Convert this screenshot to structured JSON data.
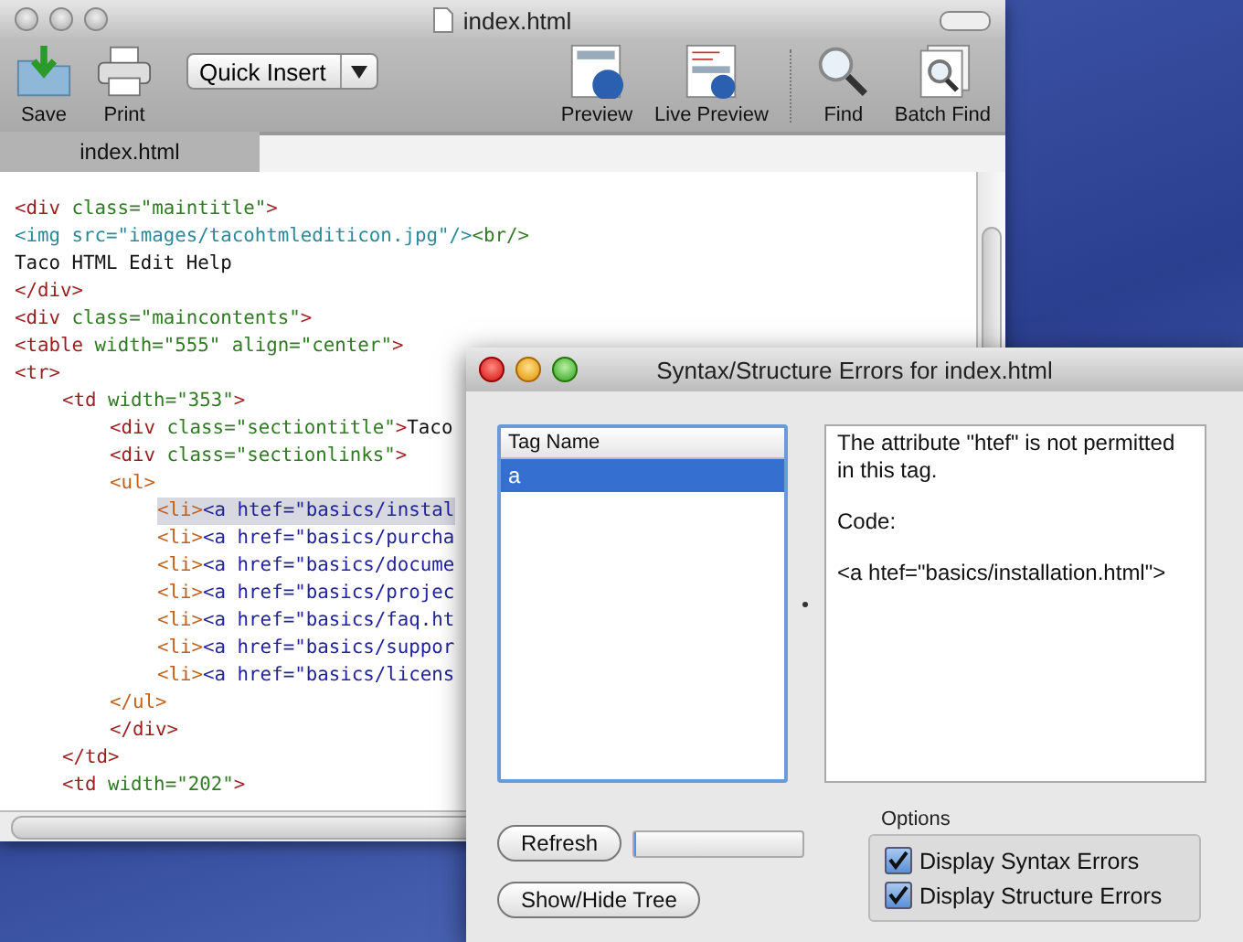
{
  "editor": {
    "title": "index.html",
    "toolbar_left": [
      {
        "label": "Save"
      },
      {
        "label": "Print"
      }
    ],
    "quick_insert": {
      "label": "Quick Insert"
    },
    "toolbar_right": [
      {
        "label": "Preview"
      },
      {
        "label": "Live Preview"
      },
      {
        "label": "Find"
      },
      {
        "label": "Batch Find"
      }
    ],
    "tabs": [
      {
        "label": "index.html",
        "selected": true
      }
    ],
    "code_lines": [
      {
        "highlighted": false,
        "segments": [
          {
            "kind": "tag",
            "text": "<div"
          },
          {
            "kind": "attr",
            "text": " class=\"maintitle\""
          },
          {
            "kind": "tag",
            "text": ">"
          }
        ]
      },
      {
        "highlighted": false,
        "segments": [
          {
            "kind": "img",
            "text": "<img src=\"images/tacohtmlediticon.jpg\"/>"
          },
          {
            "kind": "attr",
            "text": "<br/>"
          }
        ]
      },
      {
        "highlighted": false,
        "segments": [
          {
            "kind": "text",
            "text": "Taco HTML Edit Help"
          }
        ]
      },
      {
        "highlighted": false,
        "segments": [
          {
            "kind": "tag",
            "text": "</div>"
          }
        ]
      },
      {
        "highlighted": false,
        "segments": [
          {
            "kind": "tag",
            "text": "<div"
          },
          {
            "kind": "attr",
            "text": " class=\"maincontents\""
          },
          {
            "kind": "tag",
            "text": ">"
          }
        ]
      },
      {
        "highlighted": false,
        "segments": [
          {
            "kind": "tag",
            "text": "<table"
          },
          {
            "kind": "attr",
            "text": " width=\"555\" align=\"center\""
          },
          {
            "kind": "tag",
            "text": ">"
          }
        ]
      },
      {
        "highlighted": false,
        "segments": [
          {
            "kind": "tag",
            "text": "<tr>"
          }
        ],
        "children": [
          {
            "highlighted": false,
            "segments": [
              {
                "kind": "tag",
                "text": "<td"
              },
              {
                "kind": "attr",
                "text": " width=\"353\""
              },
              {
                "kind": "tag",
                "text": ">"
              }
            ],
            "children": [
              {
                "highlighted": false,
                "segments": [
                  {
                    "kind": "tag",
                    "text": "<div"
                  },
                  {
                    "kind": "attr",
                    "text": " class=\"sectiontitle\""
                  },
                  {
                    "kind": "tag",
                    "text": ">"
                  },
                  {
                    "kind": "text",
                    "text": "Taco"
                  }
                ]
              },
              {
                "highlighted": false,
                "segments": [
                  {
                    "kind": "tag",
                    "text": "<div"
                  },
                  {
                    "kind": "attr",
                    "text": " class=\"sectionlinks\""
                  },
                  {
                    "kind": "tag",
                    "text": ">"
                  }
                ]
              },
              {
                "highlighted": false,
                "segments": [
                  {
                    "kind": "list",
                    "text": "<ul>"
                  }
                ],
                "children": [
                  {
                    "highlighted": true,
                    "segments": [
                      {
                        "kind": "list",
                        "text": "<li>"
                      },
                      {
                        "kind": "link",
                        "text": "<a htef=\"basics/instal"
                      }
                    ]
                  },
                  {
                    "highlighted": false,
                    "segments": [
                      {
                        "kind": "list",
                        "text": "<li>"
                      },
                      {
                        "kind": "link",
                        "text": "<a href=\"basics/purcha"
                      }
                    ]
                  },
                  {
                    "highlighted": false,
                    "segments": [
                      {
                        "kind": "list",
                        "text": "<li>"
                      },
                      {
                        "kind": "link",
                        "text": "<a href=\"basics/docume"
                      }
                    ]
                  },
                  {
                    "highlighted": false,
                    "segments": [
                      {
                        "kind": "list",
                        "text": "<li>"
                      },
                      {
                        "kind": "link",
                        "text": "<a href=\"basics/projec"
                      }
                    ]
                  },
                  {
                    "highlighted": false,
                    "segments": [
                      {
                        "kind": "list",
                        "text": "<li>"
                      },
                      {
                        "kind": "link",
                        "text": "<a href=\"basics/faq.ht"
                      }
                    ]
                  },
                  {
                    "highlighted": false,
                    "segments": [
                      {
                        "kind": "list",
                        "text": "<li>"
                      },
                      {
                        "kind": "link",
                        "text": "<a href=\"basics/suppor"
                      }
                    ]
                  },
                  {
                    "highlighted": false,
                    "segments": [
                      {
                        "kind": "list",
                        "text": "<li>"
                      },
                      {
                        "kind": "link",
                        "text": "<a href=\"basics/licens"
                      }
                    ]
                  }
                ]
              },
              {
                "highlighted": false,
                "segments": [
                  {
                    "kind": "list",
                    "text": "</ul>"
                  }
                ]
              },
              {
                "highlighted": false,
                "segments": [
                  {
                    "kind": "tag",
                    "text": "</div>"
                  }
                ]
              }
            ]
          },
          {
            "highlighted": false,
            "segments": [
              {
                "kind": "tag",
                "text": "</td>"
              }
            ]
          },
          {
            "highlighted": false,
            "segments": [
              {
                "kind": "tag",
                "text": "<td"
              },
              {
                "kind": "attr",
                "text": " width=\"202\""
              },
              {
                "kind": "tag",
                "text": ">"
              }
            ]
          }
        ]
      }
    ]
  },
  "dialog": {
    "title": "Syntax/Structure Errors for index.html",
    "table": {
      "columns": [
        "Tag Name"
      ],
      "rows": [
        {
          "cells": [
            "a"
          ],
          "selected": true
        }
      ]
    },
    "message": [
      "The attribute \"htef\" is not permitted in this tag.",
      "Code:",
      "<a htef=\"basics/installation.html\">"
    ],
    "buttons": [
      {
        "label": "Refresh"
      },
      {
        "label": "Show/Hide Tree"
      }
    ],
    "progress": {
      "level": 0
    },
    "options": {
      "title": "Options",
      "items": [
        {
          "label": "Display Syntax Errors",
          "checked": true
        },
        {
          "label": "Display Structure Errors",
          "checked": true
        }
      ]
    }
  }
}
